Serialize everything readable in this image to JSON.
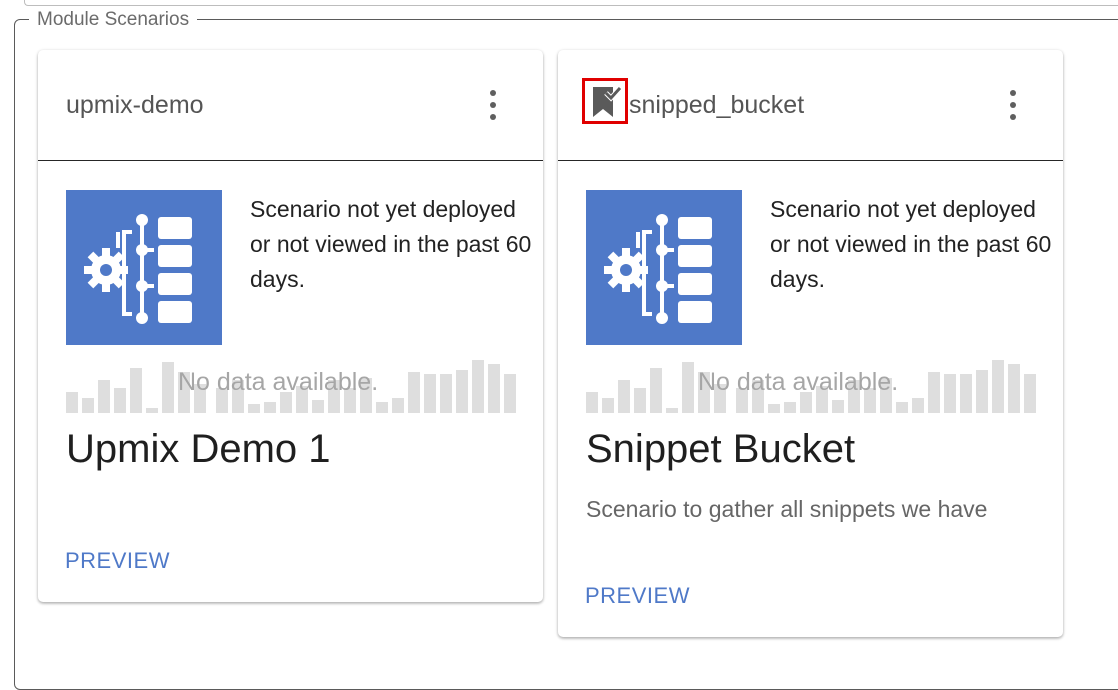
{
  "group": {
    "legend": "Module Scenarios"
  },
  "colors": {
    "accent": "#4f79c8",
    "highlight": "#e00000"
  },
  "cards": [
    {
      "name": "upmix-demo",
      "status": "Scenario not yet deployed or not viewed in the past 60 days.",
      "no_data": "No data available.",
      "title": "Upmix Demo 1",
      "description": "",
      "preview_label": "PREVIEW",
      "icons": [
        "scenario-thumbnail-icon",
        "more-vert-icon"
      ]
    },
    {
      "name": "snipped_bucket",
      "status": "Scenario not yet deployed or not viewed in the past 60 days.",
      "no_data": "No data available.",
      "title": "Snippet Bucket",
      "description": "Scenario to gather all snippets we have",
      "preview_label": "PREVIEW",
      "icons": [
        "bookmark-check-icon",
        "scenario-thumbnail-icon",
        "more-vert-icon"
      ]
    }
  ]
}
